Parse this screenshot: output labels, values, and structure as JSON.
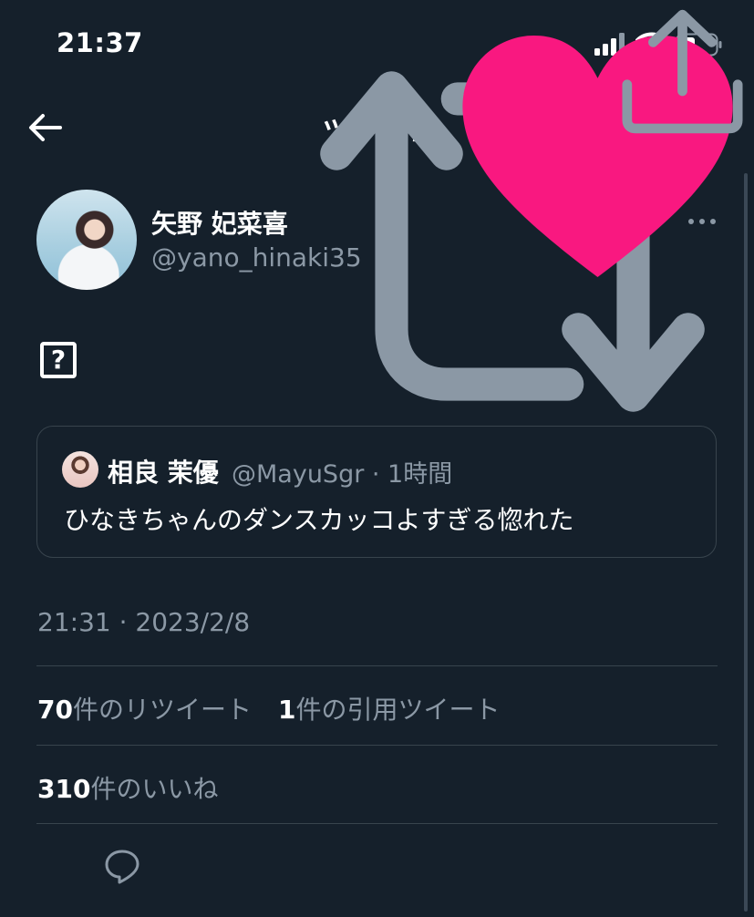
{
  "status_bar": {
    "time": "21:37",
    "icons": [
      "signal-icon",
      "wifi-icon",
      "battery-icon"
    ]
  },
  "nav": {
    "back_icon": "arrow-left-icon",
    "title": "ツイート"
  },
  "tweet": {
    "author_name": "矢野 妃菜喜",
    "author_handle": "@yano_hinaki35",
    "body_glyph": "?",
    "timestamp": "21:31 · 2023/2/8",
    "quoted": {
      "name": "相良 茉優",
      "handle": "@MayuSgr · 1時間",
      "text": "ひなきちゃんのダンスカッコよすぎる惚れた"
    },
    "stats": {
      "retweets_count": "70",
      "retweets_label": "件のリツイート",
      "quotes_count": "1",
      "quotes_label": "件の引用ツイート",
      "likes_count": "310",
      "likes_label": "件のいいね"
    }
  },
  "actions": [
    "reply-icon",
    "retweet-icon",
    "like-icon",
    "share-icon"
  ],
  "colors": {
    "background": "#15202b",
    "secondary_text": "#8b98a5",
    "divider": "#38444d",
    "like": "#f91880"
  }
}
